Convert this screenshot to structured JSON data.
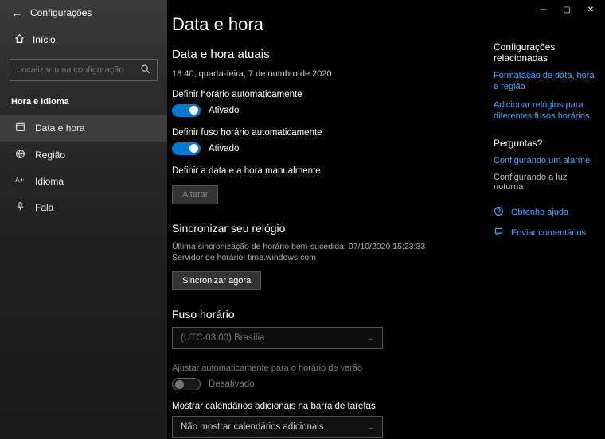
{
  "window": {
    "title": "Configurações"
  },
  "sidebar": {
    "home": "Início",
    "search_placeholder": "Localizar uma configuração",
    "category": "Hora e Idioma",
    "items": [
      {
        "label": "Data e hora",
        "icon": "calendar-clock-icon",
        "active": true
      },
      {
        "label": "Região",
        "icon": "globe-icon",
        "active": false
      },
      {
        "label": "Idioma",
        "icon": "language-icon",
        "active": false
      },
      {
        "label": "Fala",
        "icon": "microphone-icon",
        "active": false
      }
    ]
  },
  "main": {
    "heading": "Data e hora",
    "subheading": "Data e hora atuais",
    "current_time": "18:40, quarta-feira, 7 de outubro de 2020",
    "auto_time_label": "Definir horário automaticamente",
    "auto_time_state": "Ativado",
    "auto_tz_label": "Definir fuso horário automaticamente",
    "auto_tz_state": "Ativado",
    "manual_label": "Definir a data e a hora manualmente",
    "change_button": "Alterar",
    "sync_heading": "Sincronizar seu relógio",
    "sync_last": "Última sincronização de horário bem-sucedida: 07/10/2020 15:23:33",
    "sync_server": "Servidor de horário: time.windows.com",
    "sync_button": "Sincronizar agora",
    "tz_heading": "Fuso horário",
    "tz_value": "(UTC-03:00) Brasília",
    "dst_label": "Ajustar automaticamente para o horário de verão",
    "dst_state": "Desativado",
    "cal_label": "Mostrar calendários adicionais na barra de tarefas",
    "cal_value": "Não mostrar calendários adicionais"
  },
  "rside": {
    "related_heading": "Configurações relacionadas",
    "links": [
      "Formatação de data, hora e região",
      "Adicionar relógios para diferentes fusos horários"
    ],
    "questions_heading": "Perguntas?",
    "question_links": [
      "Configurando um alarme",
      "Configurando a luz noturna"
    ],
    "help": "Obtenha ajuda",
    "feedback": "Enviar comentários"
  }
}
